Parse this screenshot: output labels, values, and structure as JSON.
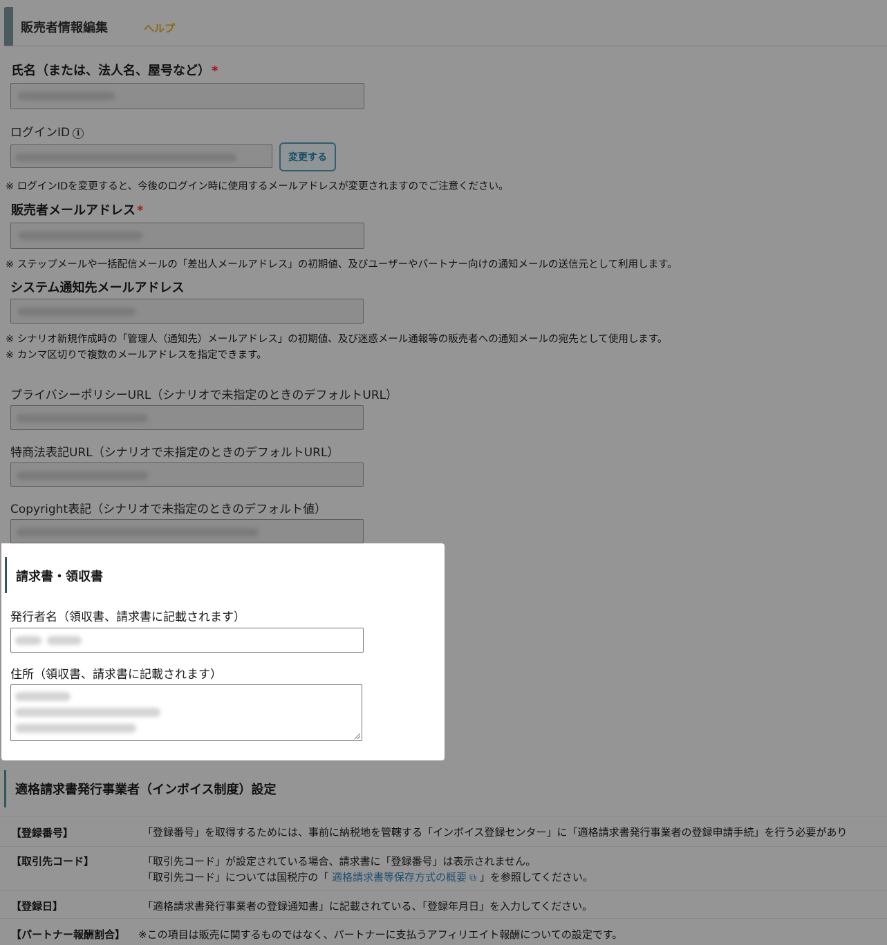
{
  "header": {
    "title": "販売者情報編集",
    "help_label": "ヘルプ"
  },
  "fields": {
    "name": {
      "label": "氏名（または、法人名、屋号など）",
      "required_mark": "*"
    },
    "login": {
      "label": "ログインID",
      "change_button": "変更する",
      "note": "※ ログインIDを変更すると、今後のログイン時に使用するメールアドレスが変更されますのでご注意ください。"
    },
    "seller_email": {
      "label": "販売者メールアドレス",
      "required_mark": "*",
      "note": "※ ステップメールや一括配信メールの「差出人メールアドレス」の初期値、及びユーザーやパートナー向けの通知メールの送信元として利用します。"
    },
    "system_email": {
      "label": "システム通知先メールアドレス",
      "note1": "※ シナリオ新規作成時の「管理人（通知先）メールアドレス」の初期値、及び迷惑メール通報等の販売者への通知メールの宛先として使用します。",
      "note2": "※ カンマ区切りで複数のメールアドレスを指定できます。"
    },
    "privacy_url": {
      "label": "プライバシーポリシーURL（シナリオで未指定のときのデフォルトURL）"
    },
    "tokushoho_url": {
      "label": "特商法表記URL（シナリオで未指定のときのデフォルトURL）"
    },
    "copyright": {
      "label": "Copyright表記（シナリオで未指定のときのデフォルト値）"
    }
  },
  "invoice_panel": {
    "title": "請求書・領収書",
    "issuer_label": "発行者名（領収書、請求書に記載されます）",
    "address_label": "住所（領収書、請求書に記載されます）"
  },
  "qualified_invoice": {
    "title": "適格請求書発行事業者（インボイス制度）設定",
    "rows": [
      {
        "label": "【登録番号】",
        "text": "「登録番号」を取得するためには、事前に納税地を管轄する「インボイス登録センター」に「適格請求書発行事業者の登録申請手続」を行う必要があり"
      },
      {
        "label": "【取引先コード】",
        "text": "「取引先コード」が設定されている場合、請求書に「登録番号」は表示されません。",
        "text2_pre": "「取引先コード」については国税庁の「 ",
        "text2_link": "適格請求書等保存方式の概要",
        "text2_post": " 」を参照してください。"
      },
      {
        "label": "【登録日】",
        "text": "「適格請求書発行事業者の登録通知書」に記載されている、「登録年月日」を入力してください。"
      },
      {
        "label": "【パートナー報酬割合】",
        "text": "※この項目は販売に関するものではなく、パートナーに支払うアフィリエイト報酬についての設定です。"
      }
    ]
  }
}
